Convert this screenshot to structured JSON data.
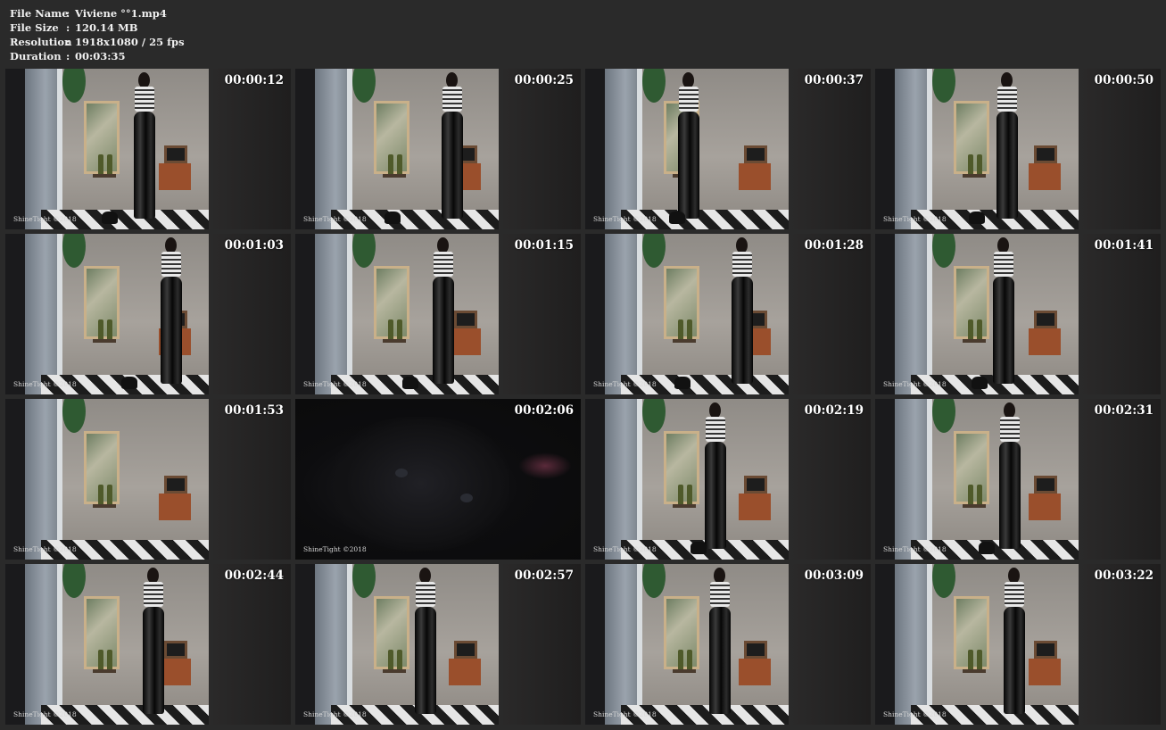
{
  "header": {
    "rows": [
      {
        "label": "File Name",
        "sep": ":",
        "value": "Viviene °°1.mp4"
      },
      {
        "label": "File Size",
        "sep": ":",
        "value": "120.14 MB"
      },
      {
        "label": "Resolution",
        "sep": ":",
        "value": "1918x1080 / 25 fps"
      },
      {
        "label": "Duration",
        "sep": ":",
        "value": "00:03:35"
      }
    ]
  },
  "thumbnails": [
    {
      "time": "00:00:12",
      "watermark": "ShineTight ©2018"
    },
    {
      "time": "00:00:25",
      "watermark": "ShineTight ©2018"
    },
    {
      "time": "00:00:37",
      "watermark": "ShineTight ©2018"
    },
    {
      "time": "00:00:50",
      "watermark": "ShineTight ©2018"
    },
    {
      "time": "00:01:03",
      "watermark": "ShineTight ©2018"
    },
    {
      "time": "00:01:15",
      "watermark": "ShineTight ©2018"
    },
    {
      "time": "00:01:28",
      "watermark": "ShineTight ©2018"
    },
    {
      "time": "00:01:41",
      "watermark": "ShineTight ©2018"
    },
    {
      "time": "00:01:53",
      "watermark": "ShineTight ©2018"
    },
    {
      "time": "00:02:06",
      "watermark": "ShineTight ©2018"
    },
    {
      "time": "00:02:19",
      "watermark": "ShineTight ©2018"
    },
    {
      "time": "00:02:31",
      "watermark": "ShineTight ©2018"
    },
    {
      "time": "00:02:44",
      "watermark": "ShineTight ©2018"
    },
    {
      "time": "00:02:57",
      "watermark": "ShineTight ©2018"
    },
    {
      "time": "00:03:09",
      "watermark": "ShineTight ©2018"
    },
    {
      "time": "00:03:22",
      "watermark": "ShineTight ©2018"
    }
  ],
  "colors": {
    "background": "#2a2a2a",
    "text": "#f0f0f0"
  }
}
